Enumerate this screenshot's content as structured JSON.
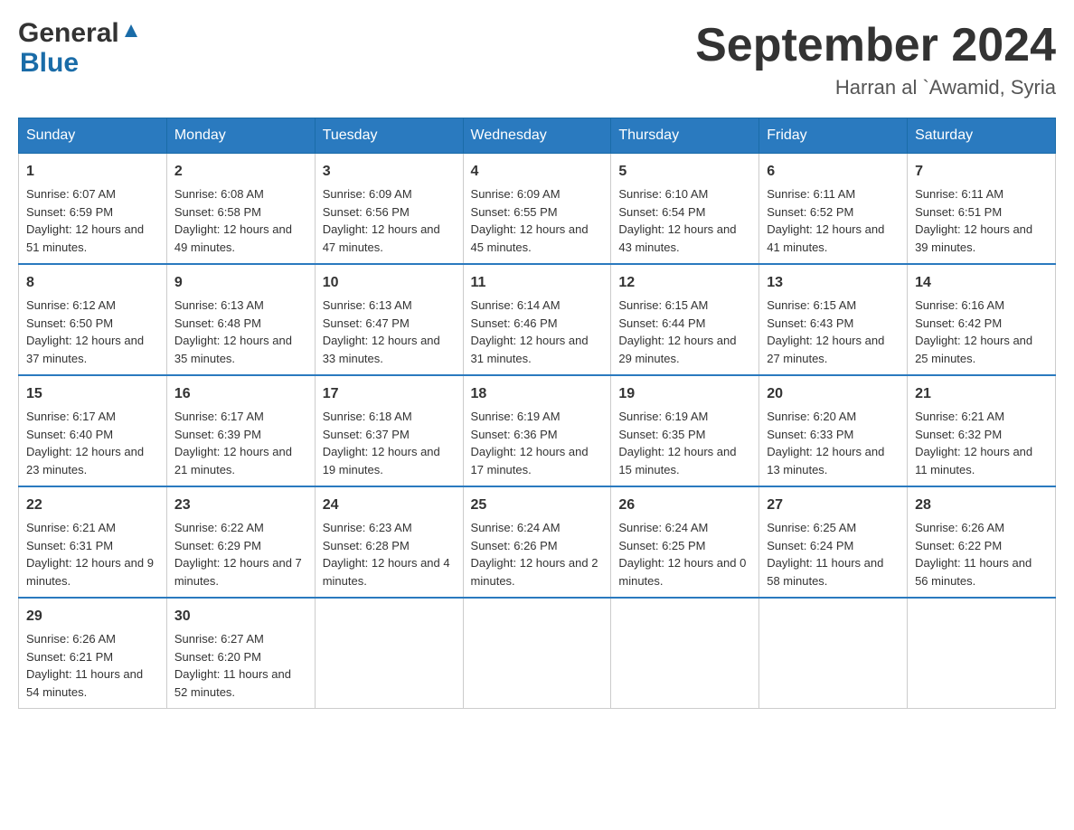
{
  "header": {
    "logo": {
      "general": "General",
      "blue": "Blue"
    },
    "title": "September 2024",
    "location": "Harran al `Awamid, Syria"
  },
  "weekdays": [
    "Sunday",
    "Monday",
    "Tuesday",
    "Wednesday",
    "Thursday",
    "Friday",
    "Saturday"
  ],
  "weeks": [
    [
      {
        "day": "1",
        "sunrise": "Sunrise: 6:07 AM",
        "sunset": "Sunset: 6:59 PM",
        "daylight": "Daylight: 12 hours and 51 minutes."
      },
      {
        "day": "2",
        "sunrise": "Sunrise: 6:08 AM",
        "sunset": "Sunset: 6:58 PM",
        "daylight": "Daylight: 12 hours and 49 minutes."
      },
      {
        "day": "3",
        "sunrise": "Sunrise: 6:09 AM",
        "sunset": "Sunset: 6:56 PM",
        "daylight": "Daylight: 12 hours and 47 minutes."
      },
      {
        "day": "4",
        "sunrise": "Sunrise: 6:09 AM",
        "sunset": "Sunset: 6:55 PM",
        "daylight": "Daylight: 12 hours and 45 minutes."
      },
      {
        "day": "5",
        "sunrise": "Sunrise: 6:10 AM",
        "sunset": "Sunset: 6:54 PM",
        "daylight": "Daylight: 12 hours and 43 minutes."
      },
      {
        "day": "6",
        "sunrise": "Sunrise: 6:11 AM",
        "sunset": "Sunset: 6:52 PM",
        "daylight": "Daylight: 12 hours and 41 minutes."
      },
      {
        "day": "7",
        "sunrise": "Sunrise: 6:11 AM",
        "sunset": "Sunset: 6:51 PM",
        "daylight": "Daylight: 12 hours and 39 minutes."
      }
    ],
    [
      {
        "day": "8",
        "sunrise": "Sunrise: 6:12 AM",
        "sunset": "Sunset: 6:50 PM",
        "daylight": "Daylight: 12 hours and 37 minutes."
      },
      {
        "day": "9",
        "sunrise": "Sunrise: 6:13 AM",
        "sunset": "Sunset: 6:48 PM",
        "daylight": "Daylight: 12 hours and 35 minutes."
      },
      {
        "day": "10",
        "sunrise": "Sunrise: 6:13 AM",
        "sunset": "Sunset: 6:47 PM",
        "daylight": "Daylight: 12 hours and 33 minutes."
      },
      {
        "day": "11",
        "sunrise": "Sunrise: 6:14 AM",
        "sunset": "Sunset: 6:46 PM",
        "daylight": "Daylight: 12 hours and 31 minutes."
      },
      {
        "day": "12",
        "sunrise": "Sunrise: 6:15 AM",
        "sunset": "Sunset: 6:44 PM",
        "daylight": "Daylight: 12 hours and 29 minutes."
      },
      {
        "day": "13",
        "sunrise": "Sunrise: 6:15 AM",
        "sunset": "Sunset: 6:43 PM",
        "daylight": "Daylight: 12 hours and 27 minutes."
      },
      {
        "day": "14",
        "sunrise": "Sunrise: 6:16 AM",
        "sunset": "Sunset: 6:42 PM",
        "daylight": "Daylight: 12 hours and 25 minutes."
      }
    ],
    [
      {
        "day": "15",
        "sunrise": "Sunrise: 6:17 AM",
        "sunset": "Sunset: 6:40 PM",
        "daylight": "Daylight: 12 hours and 23 minutes."
      },
      {
        "day": "16",
        "sunrise": "Sunrise: 6:17 AM",
        "sunset": "Sunset: 6:39 PM",
        "daylight": "Daylight: 12 hours and 21 minutes."
      },
      {
        "day": "17",
        "sunrise": "Sunrise: 6:18 AM",
        "sunset": "Sunset: 6:37 PM",
        "daylight": "Daylight: 12 hours and 19 minutes."
      },
      {
        "day": "18",
        "sunrise": "Sunrise: 6:19 AM",
        "sunset": "Sunset: 6:36 PM",
        "daylight": "Daylight: 12 hours and 17 minutes."
      },
      {
        "day": "19",
        "sunrise": "Sunrise: 6:19 AM",
        "sunset": "Sunset: 6:35 PM",
        "daylight": "Daylight: 12 hours and 15 minutes."
      },
      {
        "day": "20",
        "sunrise": "Sunrise: 6:20 AM",
        "sunset": "Sunset: 6:33 PM",
        "daylight": "Daylight: 12 hours and 13 minutes."
      },
      {
        "day": "21",
        "sunrise": "Sunrise: 6:21 AM",
        "sunset": "Sunset: 6:32 PM",
        "daylight": "Daylight: 12 hours and 11 minutes."
      }
    ],
    [
      {
        "day": "22",
        "sunrise": "Sunrise: 6:21 AM",
        "sunset": "Sunset: 6:31 PM",
        "daylight": "Daylight: 12 hours and 9 minutes."
      },
      {
        "day": "23",
        "sunrise": "Sunrise: 6:22 AM",
        "sunset": "Sunset: 6:29 PM",
        "daylight": "Daylight: 12 hours and 7 minutes."
      },
      {
        "day": "24",
        "sunrise": "Sunrise: 6:23 AM",
        "sunset": "Sunset: 6:28 PM",
        "daylight": "Daylight: 12 hours and 4 minutes."
      },
      {
        "day": "25",
        "sunrise": "Sunrise: 6:24 AM",
        "sunset": "Sunset: 6:26 PM",
        "daylight": "Daylight: 12 hours and 2 minutes."
      },
      {
        "day": "26",
        "sunrise": "Sunrise: 6:24 AM",
        "sunset": "Sunset: 6:25 PM",
        "daylight": "Daylight: 12 hours and 0 minutes."
      },
      {
        "day": "27",
        "sunrise": "Sunrise: 6:25 AM",
        "sunset": "Sunset: 6:24 PM",
        "daylight": "Daylight: 11 hours and 58 minutes."
      },
      {
        "day": "28",
        "sunrise": "Sunrise: 6:26 AM",
        "sunset": "Sunset: 6:22 PM",
        "daylight": "Daylight: 11 hours and 56 minutes."
      }
    ],
    [
      {
        "day": "29",
        "sunrise": "Sunrise: 6:26 AM",
        "sunset": "Sunset: 6:21 PM",
        "daylight": "Daylight: 11 hours and 54 minutes."
      },
      {
        "day": "30",
        "sunrise": "Sunrise: 6:27 AM",
        "sunset": "Sunset: 6:20 PM",
        "daylight": "Daylight: 11 hours and 52 minutes."
      },
      null,
      null,
      null,
      null,
      null
    ]
  ]
}
